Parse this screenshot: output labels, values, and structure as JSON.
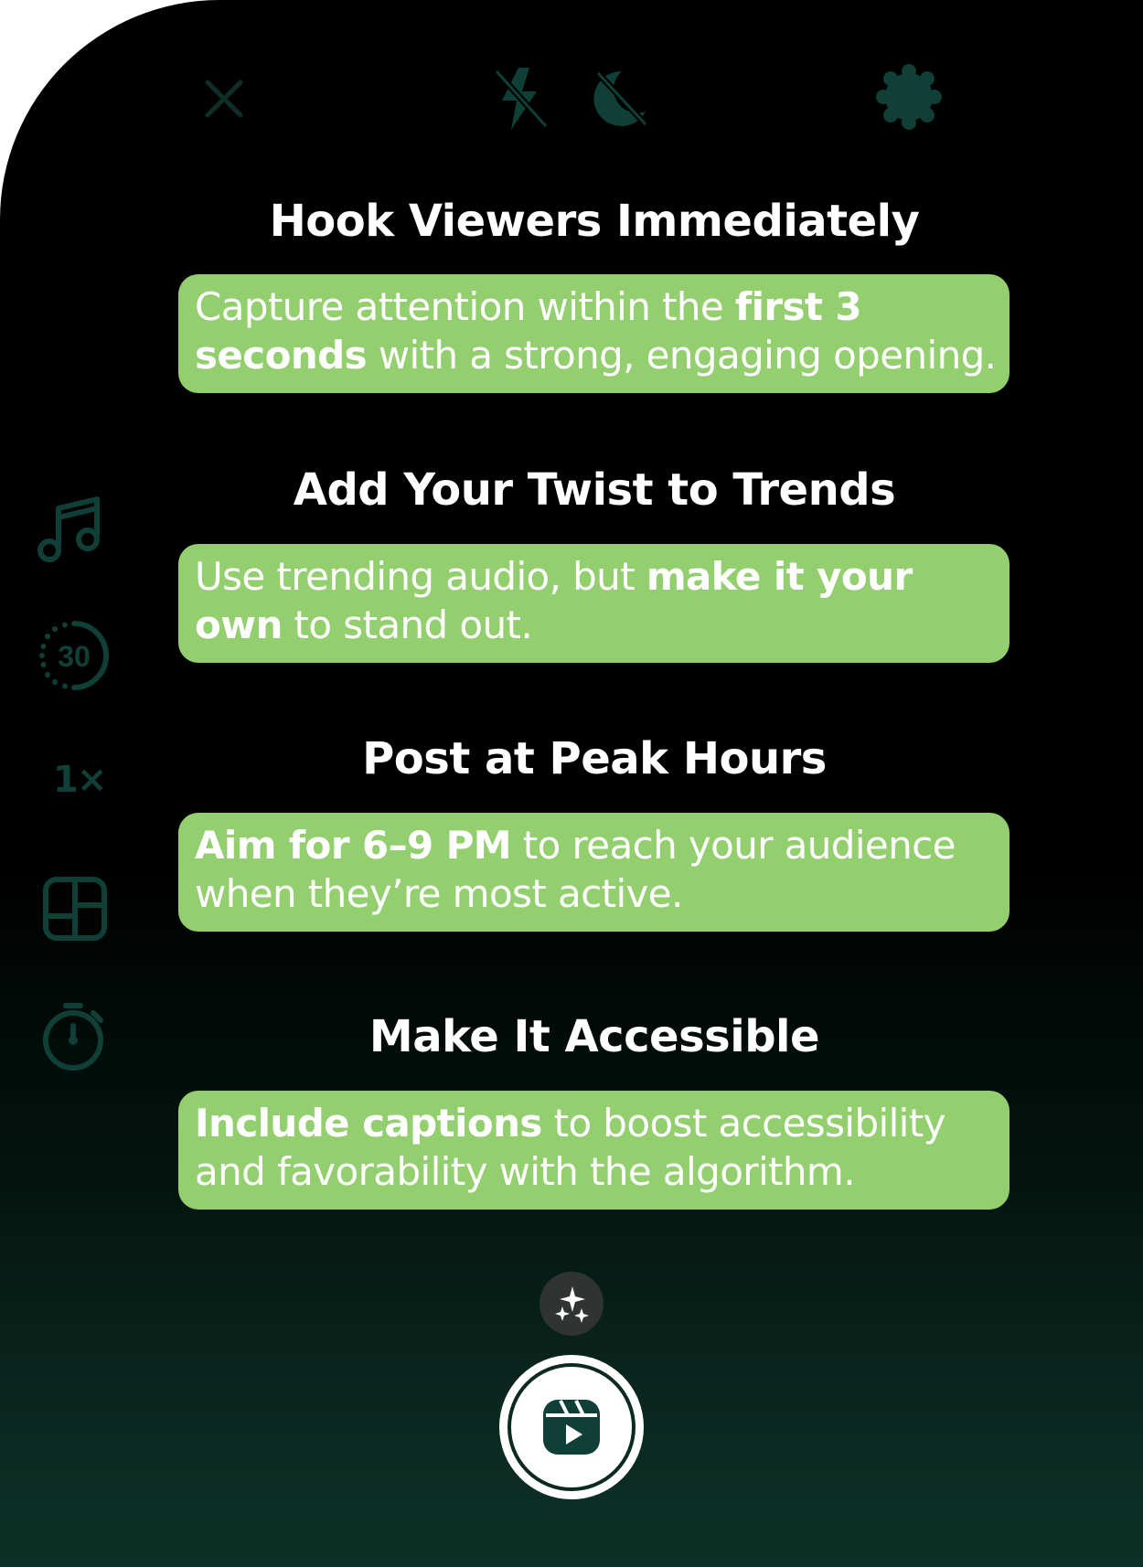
{
  "top_bar": {
    "icons": [
      "close-icon",
      "flash-off-icon",
      "night-mode-off-icon",
      "settings-icon"
    ]
  },
  "side_tools": {
    "icons": [
      "music-icon",
      "timer-30-icon",
      "speed-icon",
      "layout-icon",
      "countdown-icon"
    ],
    "timer_label": "30",
    "speed_label": "1×"
  },
  "tips": [
    {
      "title": "Hook Viewers Immediately",
      "text_pre": "Capture attention within the ",
      "text_bold": "first 3 seconds",
      "text_post": " with a strong, engaging opening."
    },
    {
      "title": "Add Your Twist to Trends",
      "text_pre": "Use trending audio, but ",
      "text_bold": "make it your own",
      "text_post": " to stand out."
    },
    {
      "title": "Post at Peak Hours",
      "text_pre": "",
      "text_bold": "Aim for 6–9 PM",
      "text_post": " to reach your audience when they’re most active."
    },
    {
      "title": "Make It Accessible",
      "text_pre": "",
      "text_bold": "Include captions",
      "text_post": " to boost accessibility and favorability with the algorithm."
    }
  ],
  "controls": {
    "effects_icon": "sparkles-icon",
    "record_icon": "reels-icon"
  },
  "colors": {
    "card_green": "#93cf6e",
    "icon_teal": "#0f3f36",
    "background": "#000000"
  }
}
